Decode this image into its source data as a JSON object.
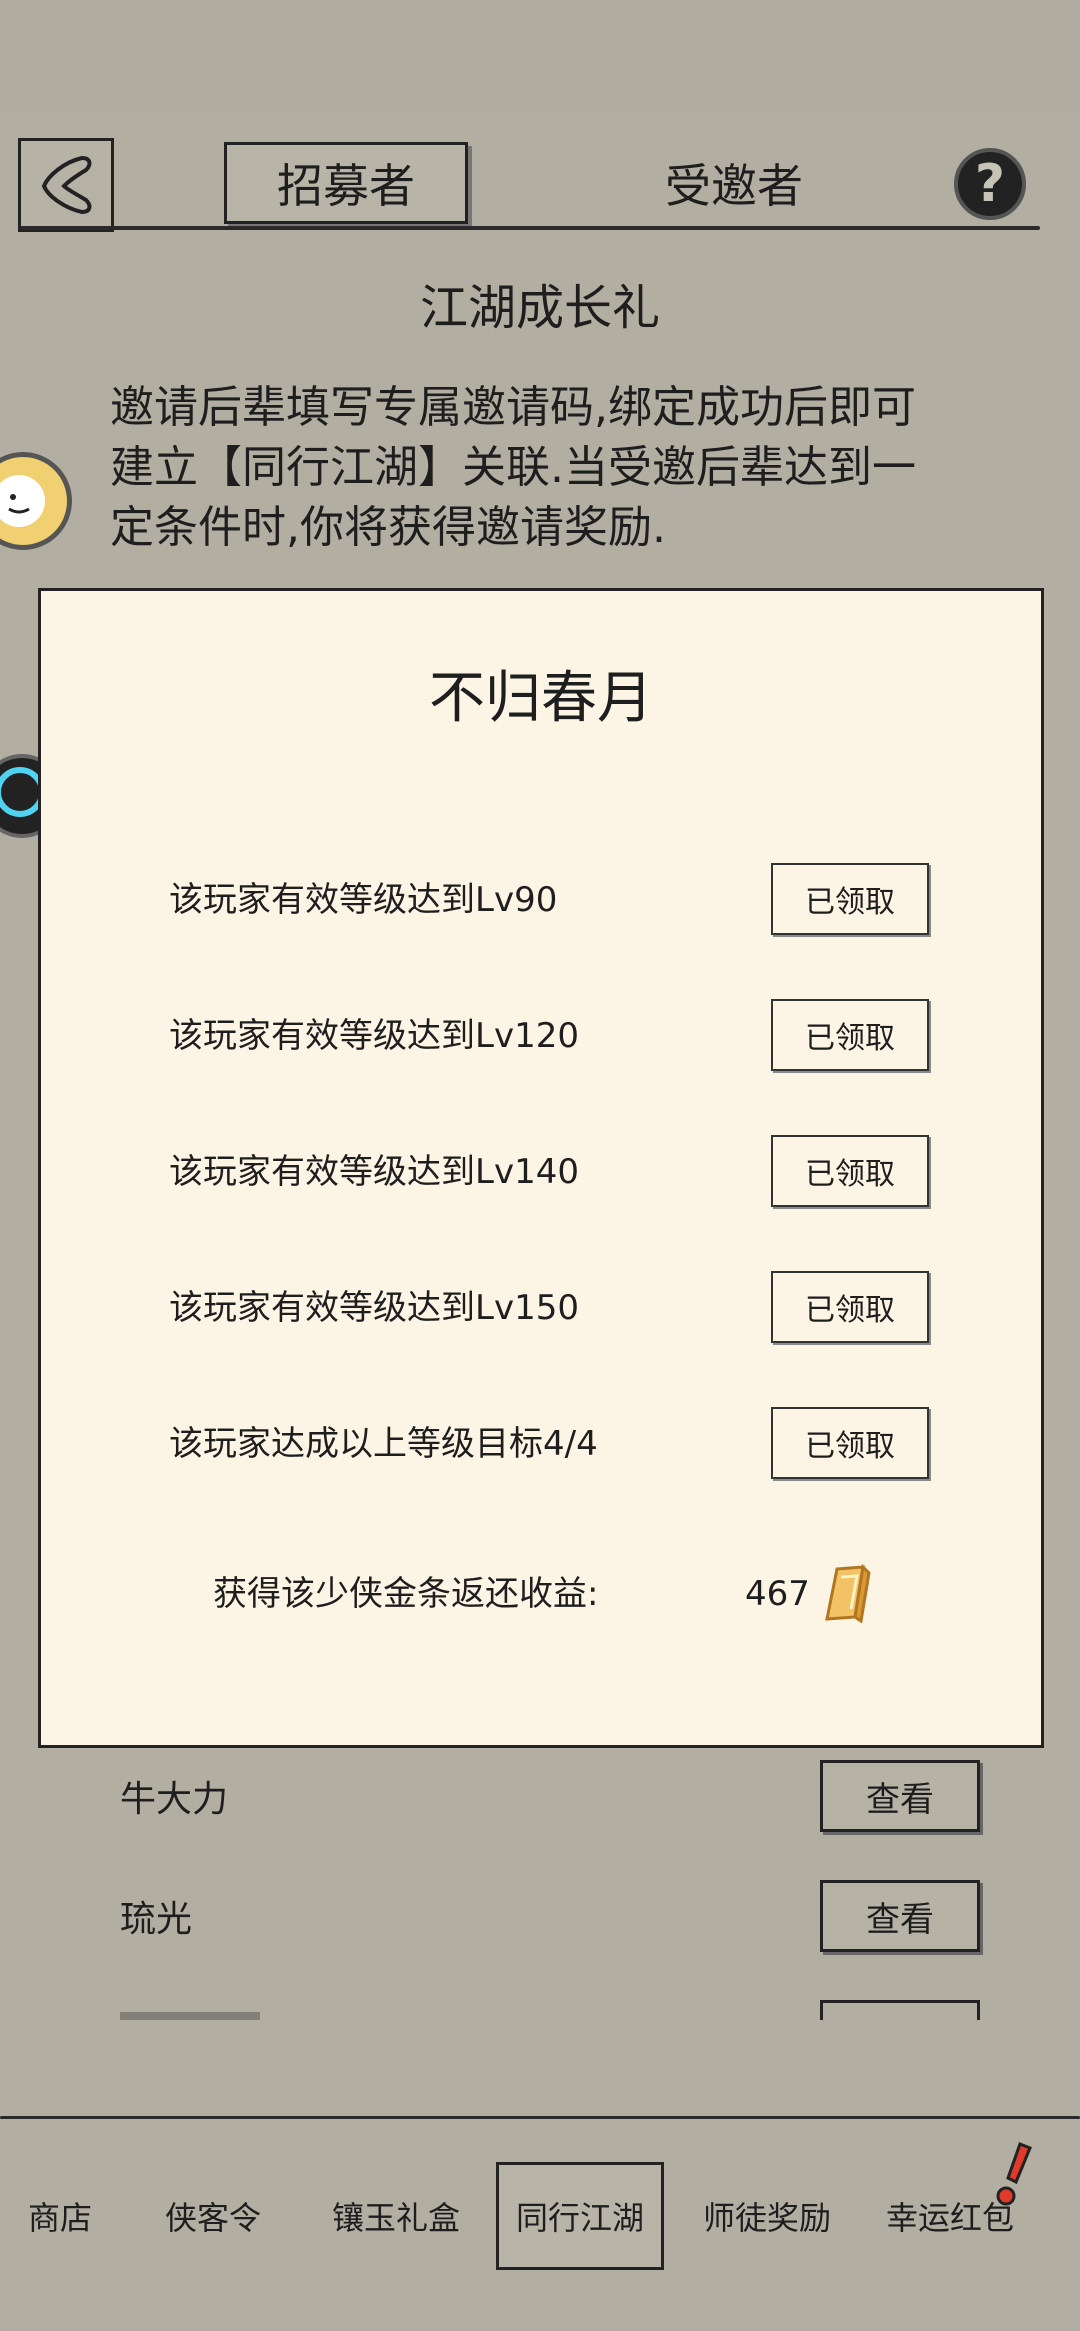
{
  "header": {
    "tabs": [
      {
        "label": "招募者",
        "active": true
      },
      {
        "label": "受邀者",
        "active": false
      }
    ],
    "help_label": "?",
    "back_icon": "back-arrow-icon"
  },
  "section": {
    "title": "江湖成长礼",
    "description": "邀请后辈填写专属邀请码,绑定成功后即可建立【同行江湖】关联.当受邀后辈达到一定条件时,你将获得邀请奖励."
  },
  "dialog": {
    "player_name": "不归春月",
    "requirements": [
      {
        "text": "该玩家有效等级达到Lv90",
        "status": "已领取"
      },
      {
        "text": "该玩家有效等级达到Lv120",
        "status": "已领取"
      },
      {
        "text": "该玩家有效等级达到Lv140",
        "status": "已领取"
      },
      {
        "text": "该玩家有效等级达到Lv150",
        "status": "已领取"
      },
      {
        "text": "该玩家达成以上等级目标4/4",
        "status": "已领取"
      }
    ],
    "reward_label": "获得该少侠金条返还收益:",
    "reward_value": "467",
    "reward_icon": "gold-bar-icon"
  },
  "list": {
    "items": [
      {
        "name": "牛大力",
        "action": "查看"
      },
      {
        "name": "琉光",
        "action": "查看"
      }
    ]
  },
  "bottom_nav": {
    "items": [
      {
        "label": "商店",
        "active": false
      },
      {
        "label": "侠客令",
        "active": false
      },
      {
        "label": "镶玉礼盒",
        "active": false
      },
      {
        "label": "同行江湖",
        "active": true
      },
      {
        "label": "师徒奖励",
        "active": false
      },
      {
        "label": "幸运红包",
        "active": false
      }
    ]
  },
  "colors": {
    "background": "#b2aea2",
    "card": "#fcf5e6",
    "ink": "#1e1e1e"
  }
}
